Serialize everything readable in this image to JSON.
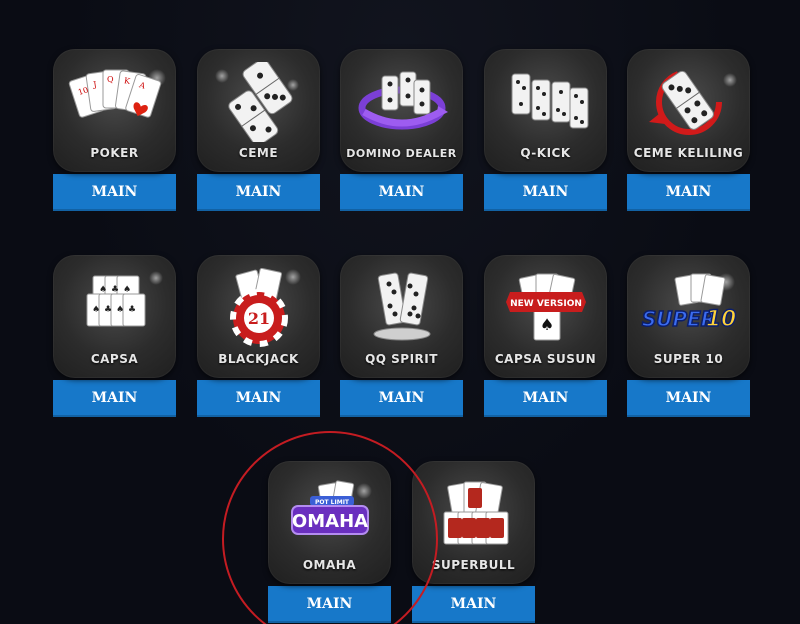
{
  "games": [
    {
      "label": "POKER",
      "button": "MAIN",
      "icon": "poker-cards-icon"
    },
    {
      "label": "CEME",
      "button": "MAIN",
      "icon": "ceme-domino-icon"
    },
    {
      "label": "DOMINO DEALER",
      "button": "MAIN",
      "icon": "domino-dealer-icon"
    },
    {
      "label": "Q-KICK",
      "button": "MAIN",
      "icon": "qkick-domino-icon"
    },
    {
      "label": "CEME KELILING",
      "button": "MAIN",
      "icon": "ceme-keliling-icon"
    },
    {
      "label": "CAPSA",
      "button": "MAIN",
      "icon": "capsa-cards-icon"
    },
    {
      "label": "BLACKJACK",
      "button": "MAIN",
      "icon": "blackjack-chip-icon"
    },
    {
      "label": "QQ SPIRIT",
      "button": "MAIN",
      "icon": "qq-spirit-domino-icon"
    },
    {
      "label": "CAPSA SUSUN",
      "button": "MAIN",
      "icon": "capsa-susun-icon"
    },
    {
      "label": "SUPER 10",
      "button": "MAIN",
      "icon": "super10-logo-icon"
    },
    {
      "label": "OMAHA",
      "button": "MAIN",
      "icon": "omaha-logo-icon"
    },
    {
      "label": "SUPERBULL",
      "button": "MAIN",
      "icon": "superbull-cards-icon"
    }
  ],
  "art_text": {
    "new_version": "NEW VERSION",
    "super": "SUPER",
    "ten": "10",
    "twenty_one": "21",
    "pot_limit": "POT LIMIT",
    "omaha": "OMAHA"
  },
  "colors": {
    "background": "#0a0c14",
    "tile": "#2c2c2c",
    "button": "#1778c9",
    "highlight_circle": "#c41c22"
  }
}
